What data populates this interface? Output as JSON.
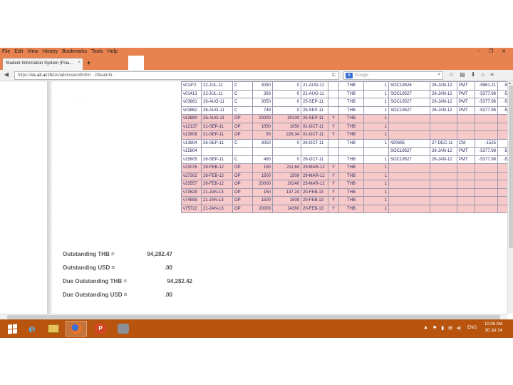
{
  "menu": [
    "File",
    "Edit",
    "View",
    "History",
    "Bookmarks",
    "Tools",
    "Help"
  ],
  "window_controls": [
    "–",
    "❐",
    "✕"
  ],
  "tab": {
    "title": "Student Information System (Fina...",
    "close": "×",
    "new_tab": "+"
  },
  "nav": {
    "back": "◀",
    "url_prefix": "https://",
    "url_host": "sis.ait.ac.th",
    "url_path": "/sis/admission/finfrm ...ilSeaInfo.",
    "reload": "C",
    "search_engine": "8",
    "search_placeholder": "Google",
    "search_icon": "magnifier-icon",
    "toolbar_icons": [
      "☆",
      "▤",
      "⬇",
      "⌂",
      "≡"
    ]
  },
  "table": {
    "rows": [
      {
        "style": "white",
        "cells": [
          "v014*2",
          "22-JUL-11",
          "C",
          "3050",
          "0",
          "21-AUG-11",
          "",
          "THB",
          "1",
          "SOC19526",
          "26-JAN-12",
          "PMT",
          "-9961.21",
          "-9961"
        ]
      },
      {
        "style": "white",
        "cells": [
          "v01413",
          "22-JUL-11",
          "C",
          "393",
          "0",
          "21-AUG-11",
          "",
          "THB",
          "1",
          "SOC19527",
          "26-JAN-12",
          "PMT",
          "-5377.98",
          "-5377"
        ]
      },
      {
        "style": "white",
        "cells": [
          "v03861",
          "26-AUG-11",
          "C",
          "3050",
          "0",
          "25-SEP-11",
          "",
          "THB",
          "1",
          "SOC19527",
          "26-JAN-12",
          "PMT",
          "-5377.98",
          "-5377"
        ]
      },
      {
        "style": "white",
        "cells": [
          "v03862",
          "26-AUG-11",
          "C",
          "749",
          "0",
          "25-SEP-11",
          "",
          "THB",
          "1",
          "SOC19527",
          "26-JAN-12",
          "PMT",
          "-5377.98",
          "-5377"
        ]
      },
      {
        "style": "pink",
        "cells": [
          "v13890",
          "26-AUG-11",
          "OP",
          "20000",
          "30100",
          "25-SEP-11",
          "Y",
          "THB",
          "1",
          "",
          "",
          "",
          "",
          ""
        ]
      },
      {
        "style": "pink",
        "cells": [
          "v12137",
          "31-SEP-11",
          "OP",
          "1050",
          "1050",
          "01-OCT-11",
          "Y",
          "THB",
          "1",
          "",
          "",
          "",
          "",
          ""
        ]
      },
      {
        "style": "pink",
        "cells": [
          "v13808",
          "31-SEP-11",
          "OP",
          "50",
          "226.34",
          "01-OCT-11",
          "Y",
          "THB",
          "1",
          "",
          "",
          "",
          "",
          ""
        ]
      },
      {
        "style": "white",
        "cells": [
          "v13804",
          "26-SEP-11",
          "C",
          "3050",
          "0",
          "26-OCT-11",
          "",
          "THB",
          "1",
          "420695",
          "27-DEC-11",
          "CM",
          "-1525",
          "-1"
        ]
      },
      {
        "style": "white",
        "cells": [
          "v15804",
          "",
          "",
          "",
          "",
          "",
          "",
          "",
          "",
          "SOC19527",
          "26-JAN-12",
          "PMT",
          "-5377.98",
          "-5377"
        ]
      },
      {
        "style": "white",
        "cells": [
          "v15805",
          "26-SEP-11",
          "C",
          "460",
          "0",
          "26-OCT-11",
          "",
          "THB",
          "1",
          "SOC19527",
          "26-JAN-12",
          "PMT",
          "-5377.98",
          "-5377"
        ]
      },
      {
        "style": "pink",
        "cells": [
          "v23076",
          "29-FEB-12",
          "OP",
          "150",
          "211.64",
          "29-MAR-12",
          "Y",
          "THB",
          "1",
          "",
          "",
          "",
          "",
          ""
        ]
      },
      {
        "style": "pink",
        "cells": [
          "v27302",
          "28-FEB-12",
          "OP",
          "1500",
          "1509",
          "29-MAR-12",
          "Y",
          "THB",
          "1",
          "",
          "",
          "",
          "",
          ""
        ]
      },
      {
        "style": "pink",
        "cells": [
          "v33557",
          "26-FEB-12",
          "OP",
          "20000",
          "20240",
          "23-MAR-12",
          "Y",
          "THB",
          "1",
          "",
          "",
          "",
          "",
          ""
        ]
      },
      {
        "style": "pink",
        "cells": [
          "v73529",
          "21-JAN-13",
          "OP",
          "150",
          "137.24",
          "20-FEB-13",
          "Y",
          "THB",
          "1",
          "",
          "",
          "",
          "",
          ""
        ]
      },
      {
        "style": "pink",
        "cells": [
          "v74599",
          "21-JAN-13",
          "OP",
          "1500",
          "1509",
          "20-FEB-13",
          "Y",
          "THB",
          "1",
          "",
          "",
          "",
          "",
          ""
        ]
      },
      {
        "style": "pink",
        "cells": [
          "v75722",
          "21-JAN-13",
          "OP",
          "20000",
          "24360",
          "20-FEB-13",
          "Y",
          "THB",
          "1",
          "",
          "",
          "",
          "",
          ""
        ]
      }
    ]
  },
  "summary": {
    "outstanding_thb_label": "Outstanding THB =",
    "outstanding_thb_value": "94,282.47",
    "outstanding_usd_label": "Outstanding USD =",
    "outstanding_usd_value": ".00",
    "due_thb_label": "Due Outstanding THB =",
    "due_thb_value": "94,282.42",
    "due_usd_label": "Due Outstanding USD =",
    "due_usd_value": ".00"
  },
  "faint_text": "· · · · · · · · ·",
  "taskbar": {
    "ppt_label": "P",
    "tray_icons": [
      "▲",
      "⚑",
      "▮",
      "⊞",
      "◂)"
    ],
    "lang": "ENG",
    "time": "10:06 AM",
    "date": "30 Jul 14"
  },
  "colors": {
    "firefox_orange": "#e8834f",
    "taskbar": "#b8540e",
    "row_pink": "#f8c9c9",
    "table_text": "#2a2a60"
  }
}
